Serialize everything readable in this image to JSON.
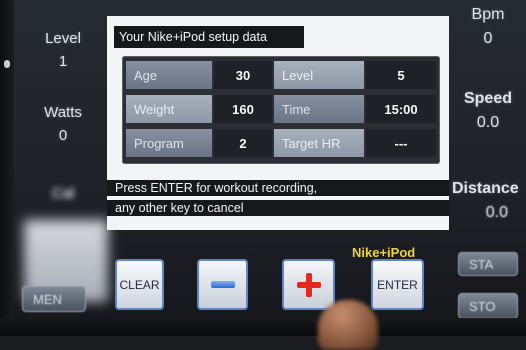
{
  "left_stats": {
    "level": {
      "label": "Level",
      "value": "1"
    },
    "watts": {
      "label": "Watts",
      "value": "0"
    },
    "cal": {
      "label": "Cal"
    }
  },
  "right_stats": {
    "bpm": {
      "label": "Bpm",
      "value": "0"
    },
    "speed": {
      "label": "Speed",
      "value": "0.0"
    },
    "distance": {
      "label": "Distance",
      "value": "0.0"
    }
  },
  "panel": {
    "title": "Your Nike+iPod setup data",
    "rows": [
      {
        "label_a": "Age",
        "value_a": "30",
        "label_b": "Level",
        "value_b": "5"
      },
      {
        "label_a": "Weight",
        "value_a": "160",
        "label_b": "Time",
        "value_b": "15:00"
      },
      {
        "label_a": "Program",
        "value_a": "2",
        "label_b": "Target HR",
        "value_b": "---"
      }
    ],
    "message_line1": "Press ENTER for workout recording,",
    "message_line2": "any other key to cancel"
  },
  "buttons": {
    "clear": "CLEAR",
    "enter": "ENTER",
    "nike_label": "Nike+iPod",
    "start": "STA",
    "stop": "STO",
    "left_ghost": "MEN"
  },
  "colors": {
    "accent_border": "#5e86c7",
    "plus_red": "#e42a1f",
    "minus_blue": "#2b6bd0",
    "nike_label": "#f0d33a"
  },
  "icons": {
    "minus": "minus-icon",
    "plus": "plus-icon"
  }
}
